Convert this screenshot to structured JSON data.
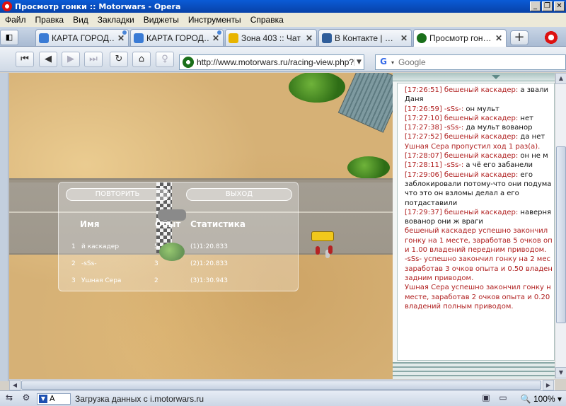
{
  "window": {
    "title": "Просмотр гонки :: Motorwars - Opera",
    "min": "_",
    "max": "❐",
    "close": "✕"
  },
  "menu": [
    "Файл",
    "Правка",
    "Вид",
    "Закладки",
    "Виджеты",
    "Инструменты",
    "Справка"
  ],
  "tabs": [
    {
      "label": "КАРТА ГОРОД…",
      "close": "✕",
      "icon_color": "#3a7bd5"
    },
    {
      "label": "КАРТА ГОРОД…",
      "close": "✕",
      "icon_color": "#3a7bd5"
    },
    {
      "label": "Зона 403 :: Чат",
      "close": "✕",
      "icon_color": "#e8b400"
    },
    {
      "label": "В Контакте | …",
      "close": "✕",
      "icon_color": "#2f5d9a"
    },
    {
      "label": "Просмотр гон…",
      "close": "✕",
      "icon_color": "#1a6f1a"
    }
  ],
  "newtab": "+",
  "nav": {
    "url": "http://www.motorwars.ru/racing-view.php?ra",
    "search_placeholder": "Google"
  },
  "overlay": {
    "replay": "ПОВТОРИТЬ",
    "exit": "ВЫХОД",
    "headers": {
      "name": "Имя",
      "exp": "Опыт",
      "stats": "Статистика"
    },
    "rows": [
      {
        "pos": "1",
        "name": "й каскадер",
        "exp": "5",
        "time": "(1)1:20.833"
      },
      {
        "pos": "2",
        "name": "-sSs-",
        "exp": "3",
        "time": "(2)1:20.833"
      },
      {
        "pos": "3",
        "name": "Ушная Сера",
        "exp": "2",
        "time": "(3)1:30.943"
      }
    ]
  },
  "chat": [
    {
      "color": "red",
      "text": "[17:26:51] бешеный каскадер:",
      "rest": " а звали"
    },
    {
      "color": "black",
      "text": "Даня",
      "rest": ""
    },
    {
      "color": "red",
      "text": "[17:26:59] -sSs-:",
      "rest": " он мульт"
    },
    {
      "color": "red",
      "text": "[17:27:10] бешеный каскадер:",
      "rest": " нет"
    },
    {
      "color": "red",
      "text": "[17:27:38] -sSs-:",
      "rest": " да мульт вованор"
    },
    {
      "color": "red",
      "text": "[17:27:52] бешеный каскадер:",
      "rest": " да нет"
    },
    {
      "color": "red",
      "text": "Ушная Сера пропустил ход 1 раз(а).",
      "rest": ""
    },
    {
      "color": "red",
      "text": "[17:28:07] бешеный каскадер:",
      "rest": " он не м"
    },
    {
      "color": "red",
      "text": "[17:28:11] -sSs-:",
      "rest": " а чё его забанели"
    },
    {
      "color": "red",
      "text": "[17:29:06] бешеный каскадер:",
      "rest": " его"
    },
    {
      "color": "black",
      "text": "заблокировали потому-что они подума",
      "rest": ""
    },
    {
      "color": "black",
      "text": "что это он взломы делал а его",
      "rest": ""
    },
    {
      "color": "black",
      "text": "потдаставили",
      "rest": ""
    },
    {
      "color": "red",
      "text": "[17:29:37] бешеный каскадер:",
      "rest": " наверня"
    },
    {
      "color": "black",
      "text": "вованор они ж враги",
      "rest": ""
    },
    {
      "color": "red",
      "text": "бешеный каскадер успешно закончил",
      "rest": ""
    },
    {
      "color": "red",
      "text": "гонку на 1 месте, заработав 5 очков оп",
      "rest": ""
    },
    {
      "color": "red",
      "text": "и 1.00 владений передним приводом.",
      "rest": ""
    },
    {
      "color": "red",
      "text": "-sSs- успешно закончил гонку на 2 мес",
      "rest": ""
    },
    {
      "color": "red",
      "text": "заработав 3 очков опыта и 0.50 владен",
      "rest": ""
    },
    {
      "color": "red",
      "text": "задним приводом.",
      "rest": ""
    },
    {
      "color": "red",
      "text": "Ушная Сера успешно закончил гонку н",
      "rest": ""
    },
    {
      "color": "red",
      "text": "месте, заработав 2 очков опыта и 0.20",
      "rest": ""
    },
    {
      "color": "red",
      "text": "владений полным приводом.",
      "rest": ""
    }
  ],
  "status": {
    "lang": "А",
    "text": "Загрузка данных с i.motorwars.ru",
    "zoom": "100%"
  }
}
